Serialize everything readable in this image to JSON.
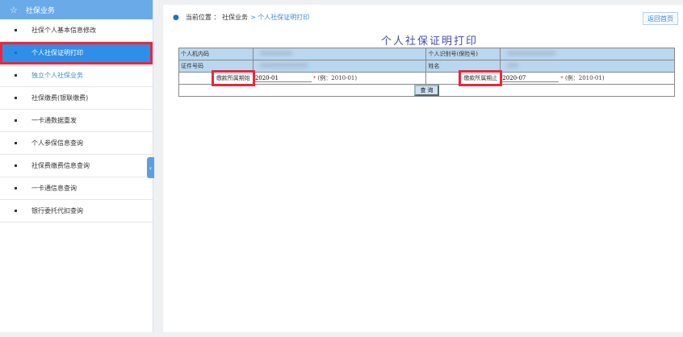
{
  "sidebar": {
    "header": "社保业务",
    "items": [
      {
        "label": "社保个人基本信息修改"
      },
      {
        "label": "个人社保证明打印"
      },
      {
        "label": "独立个人社保业务"
      },
      {
        "label": "社保缴费(银联缴费)"
      },
      {
        "label": "一卡通数据重发"
      },
      {
        "label": "个人参保信息查询"
      },
      {
        "label": "社保费缴费信息查询"
      },
      {
        "label": "一卡通信息查询"
      },
      {
        "label": "银行委托代扣查询"
      }
    ]
  },
  "breadcrumb": {
    "prefix": "当前位置 ：",
    "parent": "社保业务",
    "current": "> 个人社保证明打印"
  },
  "home_button": "返回首页",
  "form": {
    "title": "个人社保证明打印",
    "internal_code_label": "个人机内码",
    "id_no_label": "个人识别号(保险号)",
    "cert_no_label": "证件号码",
    "name_label": "姓名",
    "start_label": "缴款所属期始",
    "start_value": "2020-01",
    "end_label": "缴款所属期止",
    "end_value": "2020-07",
    "required": "*",
    "hint": "(例：2010-01)",
    "query_button": "查 询"
  }
}
